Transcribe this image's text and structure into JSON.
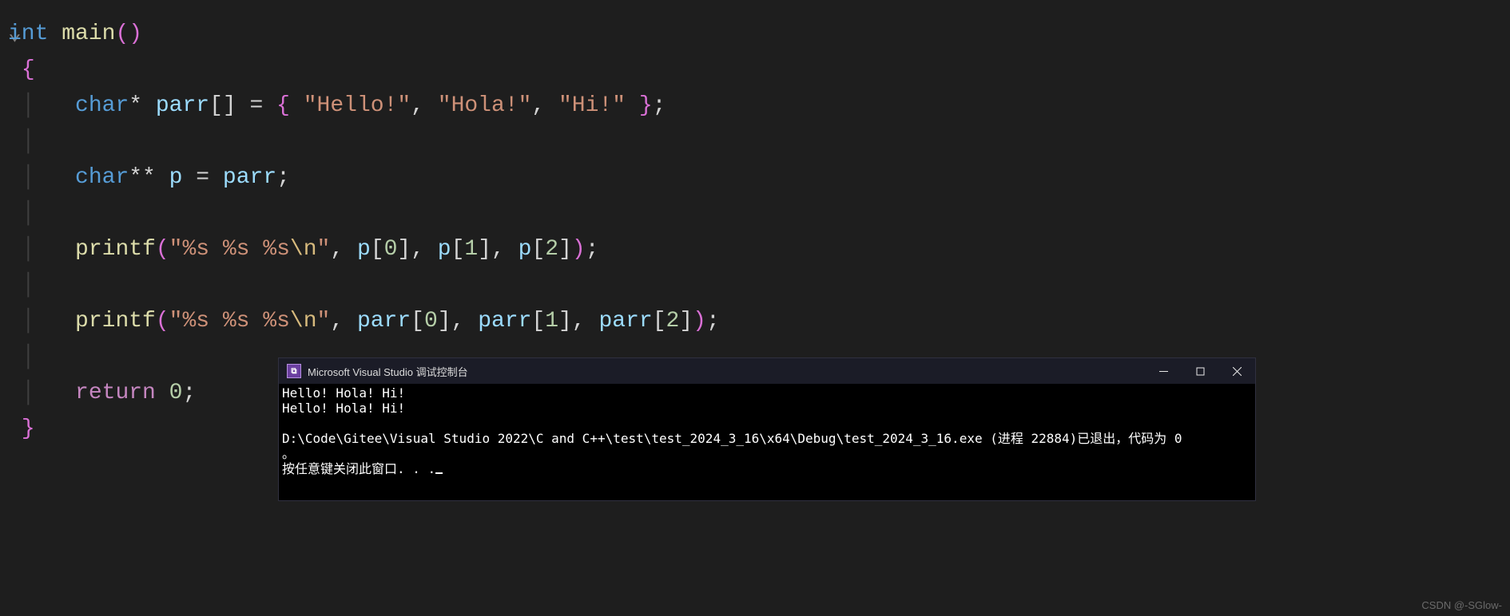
{
  "code": {
    "l1": {
      "fold": "⌄",
      "type": "int",
      "fn": "main",
      "open": "(",
      "close": ")"
    },
    "l2": {
      "brace": "{"
    },
    "l3": {
      "guide": "│   ",
      "type": "char",
      "star": "*",
      "id": "parr",
      "brackets": "[]",
      "eq": " = ",
      "opencb": "{ ",
      "s1": "\"Hello!\"",
      "c1": ", ",
      "s2": "\"Hola!\"",
      "c2": ", ",
      "s3": "\"Hi!\"",
      "closecb": " }",
      "semi": ";"
    },
    "l4": {
      "guide": "│"
    },
    "l5": {
      "guide": "│   ",
      "type": "char",
      "stars": "**",
      "id": "p",
      "eq": " = ",
      "rhs": "parr",
      "semi": ";"
    },
    "l6": {
      "guide": "│"
    },
    "l7": {
      "guide": "│   ",
      "fn": "printf",
      "open": "(",
      "fmt1": "\"%s %s %s",
      "esc": "\\n",
      "fmt2": "\"",
      "c1": ", ",
      "a1": "p",
      "b1": "[",
      "n1": "0",
      "bb1": "]",
      "c2": ", ",
      "a2": "p",
      "b2": "[",
      "n2": "1",
      "bb2": "]",
      "c3": ", ",
      "a3": "p",
      "b3": "[",
      "n3": "2",
      "bb3": "]",
      "close": ")",
      "semi": ";"
    },
    "l8": {
      "guide": "│"
    },
    "l9": {
      "guide": "│   ",
      "fn": "printf",
      "open": "(",
      "fmt1": "\"%s %s %s",
      "esc": "\\n",
      "fmt2": "\"",
      "c1": ", ",
      "a1": "parr",
      "b1": "[",
      "n1": "0",
      "bb1": "]",
      "c2": ", ",
      "a2": "parr",
      "b2": "[",
      "n2": "1",
      "bb2": "]",
      "c3": ", ",
      "a3": "parr",
      "b3": "[",
      "n3": "2",
      "bb3": "]",
      "close": ")",
      "semi": ";"
    },
    "l10": {
      "guide": "│"
    },
    "l11": {
      "guide": "│   ",
      "ret": "return",
      "sp": " ",
      "num": "0",
      "semi": ";"
    },
    "l12": {
      "brace": "}"
    }
  },
  "console": {
    "title": "Microsoft Visual Studio 调试控制台",
    "out1": "Hello! Hola! Hi!",
    "out2": "Hello! Hola! Hi!",
    "blank": "",
    "out3": "D:\\Code\\Gitee\\Visual Studio 2022\\C and C++\\test\\test_2024_3_16\\x64\\Debug\\test_2024_3_16.exe (进程 22884)已退出，代码为 0",
    "out3b": "。",
    "out4": "按任意键关闭此窗口. . ."
  },
  "watermark": "CSDN @-SGlow-"
}
